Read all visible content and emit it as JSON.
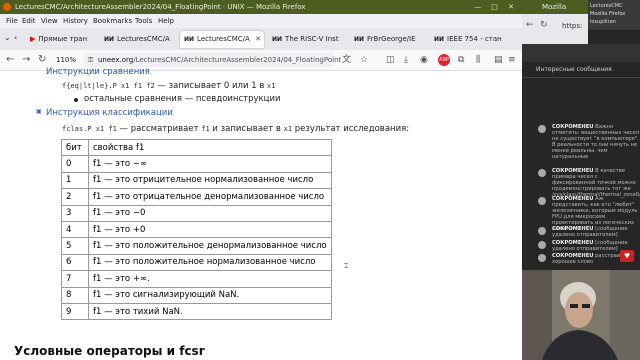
{
  "window": {
    "title": "LecturesCMC/ArchitectureAssembler2024/04_FloatingPoint · UNIX — Mozilla Firefox",
    "buttons": "— □ ✕"
  },
  "menu": [
    "File",
    "Edit",
    "View",
    "History",
    "Bookmarks",
    "Tools",
    "Help"
  ],
  "tabs": [
    {
      "icon": "▶",
      "label": "Прямые тран"
    },
    {
      "icon": "ИИ",
      "label": "LecturesCMC/A"
    },
    {
      "icon": "ИИ",
      "label": "LecturesCMC/A"
    },
    {
      "icon": "ИИ",
      "label": "The RISC-V Inst"
    },
    {
      "icon": "ИИ",
      "label": "FrBrGeorge/IE"
    },
    {
      "icon": "ИИ",
      "label": "IEEE 754 - стан"
    }
  ],
  "nav": {
    "zoom": "110%",
    "url_domain": "uneex.org",
    "url_path": "/LecturesCMC/ArchitectureAssembler2024/04_FloatingPoint"
  },
  "content": {
    "top_link": "Инструкции сравнения",
    "feq_code": "f{eq|lt|le}.P x1 f1 f2",
    "feq_text": " — записывает 0 или 1 в ",
    "feq_reg": "x1",
    "bullet_text": "остальные сравнения — псевдоинструкции",
    "classify_link": "Инструкция классификации",
    "fclass_code": "fclas.P x1 f1",
    "fclass_text": " — рассматривает ",
    "fclass_reg": "f1",
    "fclass_text2": " и записывает в ",
    "fclass_reg2": "x1",
    "fclass_text3": " результат исследования:",
    "table_header": [
      "бит",
      "свойства f1"
    ],
    "table_rows": [
      [
        "0",
        "f1 — это −∞"
      ],
      [
        "1",
        "f1 — это отрицительное нормализованное число"
      ],
      [
        "2",
        "f1 — это отрицательное денормализованное число"
      ],
      [
        "3",
        "f1 — это −0"
      ],
      [
        "4",
        "f1 — это +0"
      ],
      [
        "5",
        "f1 — это положительное денормализованное число"
      ],
      [
        "6",
        "f1 — это положительное нормализованное число"
      ],
      [
        "7",
        "f1 — это +∞."
      ],
      [
        "8",
        "f1 — это сигнализирующий NaN."
      ],
      [
        "9",
        "f1 — это тихий NaN."
      ]
    ],
    "next_heading": "Условные операторы и fcsr"
  },
  "side": {
    "title": "Mozilla",
    "mini_tabs": "LecturesCMC\nMozilla Firefox\nlosupiliran",
    "url": "https:",
    "chat_header": "Интересные сообщения",
    "messages": [
      {
        "who": "СОКРОМЕНЕU",
        "text": "Важно отметить: вещественных чисел не существует \"в компьютере\". В реальности то они ничуть не менее реальны, чем натуральные"
      },
      {
        "who": "СОКРОМЕНЕU",
        "text": "В качестве примера чисел с фиксированной точкой можно продемонстрировать тот же /sys/class/thermal/thermal_zone0/temp"
      },
      {
        "who": "СОКРОМЕНЕU",
        "text": "Аж представить, как кто \"любит\" железячники, которым модуль FPU для микросхем проектировать из логических элементов"
      },
      {
        "who": "СОКРОМЕНЕU",
        "text": "[сообщение удалено отправителем]"
      },
      {
        "who": "СОКРОМЕНЕU",
        "text": "[сообщение удалено отправителем]"
      },
      {
        "who": "СОКРОМЕНЕU",
        "text": "расстраивает хорошее слово"
      }
    ]
  }
}
